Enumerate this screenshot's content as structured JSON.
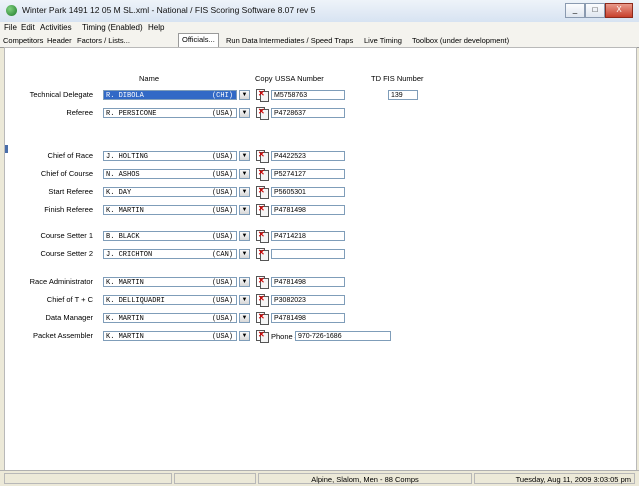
{
  "window": {
    "title": "Winter Park 1491 12 05 M SL.xml - National / FIS Scoring Software 8.07 rev 5",
    "buttons": [
      "_",
      "□",
      "X"
    ]
  },
  "menu": [
    "File",
    "Edit",
    "Activities",
    "Timing (Enabled)",
    "Help"
  ],
  "tabs": [
    {
      "label": "Competitors"
    },
    {
      "label": "Header"
    },
    {
      "label": "Factors / Lists..."
    },
    {
      "label": "Officials..."
    },
    {
      "label": "Run Data"
    },
    {
      "label": "Intermediates / Speed Traps"
    },
    {
      "label": "Live Timing"
    },
    {
      "label": "Toolbox (under development)"
    }
  ],
  "headers": {
    "name": "Name",
    "copy": "Copy",
    "ussa": "USSA Number",
    "tdfis": "TD FIS Number"
  },
  "officials": [
    {
      "role": "Technical Delegate",
      "name": "R. DIBOLA",
      "nat": "(CHI)",
      "ussa": "M5758763",
      "td": "139",
      "selected": true
    },
    {
      "role": "Referee",
      "name": "R. PERSICONE",
      "nat": "(USA)",
      "ussa": "P4728637"
    },
    {
      "role": "Chief of Race",
      "name": "J. HOLTING",
      "nat": "(USA)",
      "ussa": "P4422523"
    },
    {
      "role": "Chief of Course",
      "name": "N. ASHOS",
      "nat": "(USA)",
      "ussa": "P5274127"
    },
    {
      "role": "Start Referee",
      "name": "K. DAY",
      "nat": "(USA)",
      "ussa": "P5605301"
    },
    {
      "role": "Finish Referee",
      "name": "K. MARTIN",
      "nat": "(USA)",
      "ussa": "P4781498"
    },
    {
      "role": "Course Setter 1",
      "name": "B. BLACK",
      "nat": "(USA)",
      "ussa": "P4714218"
    },
    {
      "role": "Course Setter 2",
      "name": "J. CRICHTON",
      "nat": "(CAN)",
      "ussa": ""
    },
    {
      "role": "Race Administrator",
      "name": "K. MARTIN",
      "nat": "(USA)",
      "ussa": "P4781498"
    },
    {
      "role": "Chief of T + C",
      "name": "K. DELLIQUADRI",
      "nat": "(USA)",
      "ussa": "P3082023"
    },
    {
      "role": "Data Manager",
      "name": "K. MARTIN",
      "nat": "(USA)",
      "ussa": "P4781498"
    },
    {
      "role": "Packet Assembler",
      "name": "K. MARTIN",
      "nat": "(USA)",
      "phone_label": "Phone #",
      "phone": "970-726-1686"
    }
  ],
  "status": {
    "race": "Alpine, Slalom, Men - 88 Comps",
    "datetime": "Tuesday, Aug 11, 2009  3:03:05 pm"
  }
}
